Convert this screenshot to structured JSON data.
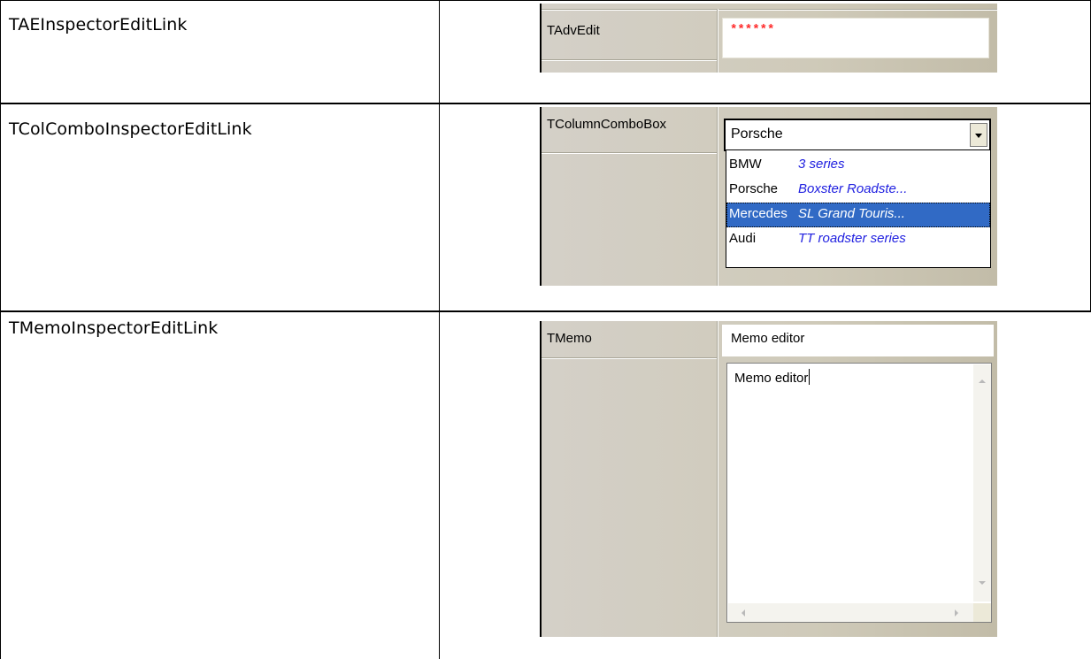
{
  "rows": [
    {
      "label": "TAEInspectorEditLink",
      "inspector": {
        "property": "TAdvEdit",
        "value": "******"
      }
    },
    {
      "label": "TColComboInspectorEditLink",
      "inspector": {
        "property": "TColumnComboBox",
        "value": "Porsche",
        "items": [
          {
            "make": "BMW",
            "model": "3 series",
            "selected": false
          },
          {
            "make": "Porsche",
            "model": "Boxster Roadste...",
            "selected": false
          },
          {
            "make": "Mercedes",
            "model": "SL Grand Touris...",
            "selected": true
          },
          {
            "make": "Audi",
            "model": "TT roadster series",
            "selected": false
          }
        ]
      }
    },
    {
      "label": "TMemoInspectorEditLink",
      "inspector": {
        "property": "TMemo",
        "value": "Memo editor",
        "memo_text": "Memo editor"
      }
    }
  ],
  "colors": {
    "password_red": "#ff2a2a",
    "model_blue": "#2020e0",
    "selection_blue": "#316ac5",
    "panel_beige": "#cfcab9"
  }
}
